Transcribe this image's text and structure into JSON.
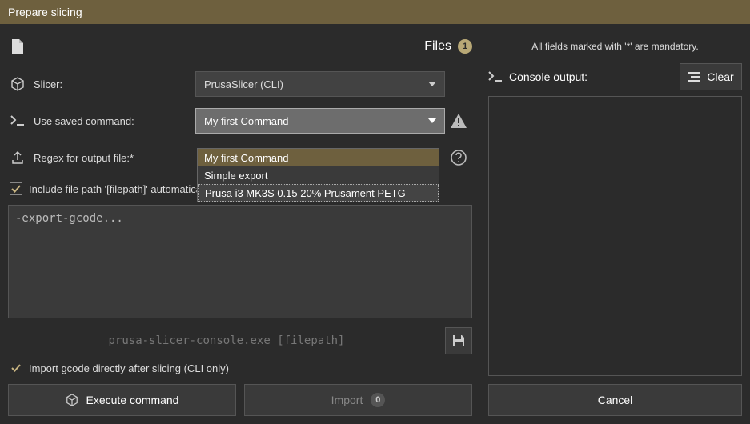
{
  "title": "Prepare slicing",
  "files": {
    "label": "Files",
    "count": "1"
  },
  "slicer": {
    "label": "Slicer:",
    "value": "PrusaSlicer (CLI)"
  },
  "savedCommand": {
    "label": "Use saved command:",
    "value": "My first Command",
    "options": [
      "My first Command",
      "Simple export",
      "Prusa i3 MK3S 0.15 20% Prusament PETG"
    ]
  },
  "regex": {
    "label": "Regex for output file:*"
  },
  "includeFilepath": {
    "label": "Include file path '[filepath]' automatically at end of command"
  },
  "commandText": "-export-gcode...",
  "commandPreview": "prusa-slicer-console.exe  [filepath]",
  "importAfter": {
    "label": "Import gcode directly after slicing (CLI only)"
  },
  "buttons": {
    "execute": "Execute command",
    "import": "Import",
    "importCount": "0",
    "cancel": "Cancel",
    "clear": "Clear"
  },
  "right": {
    "mandatoryHint": "All fields marked with '*' are mandatory.",
    "consoleLabel": "Console output:"
  }
}
